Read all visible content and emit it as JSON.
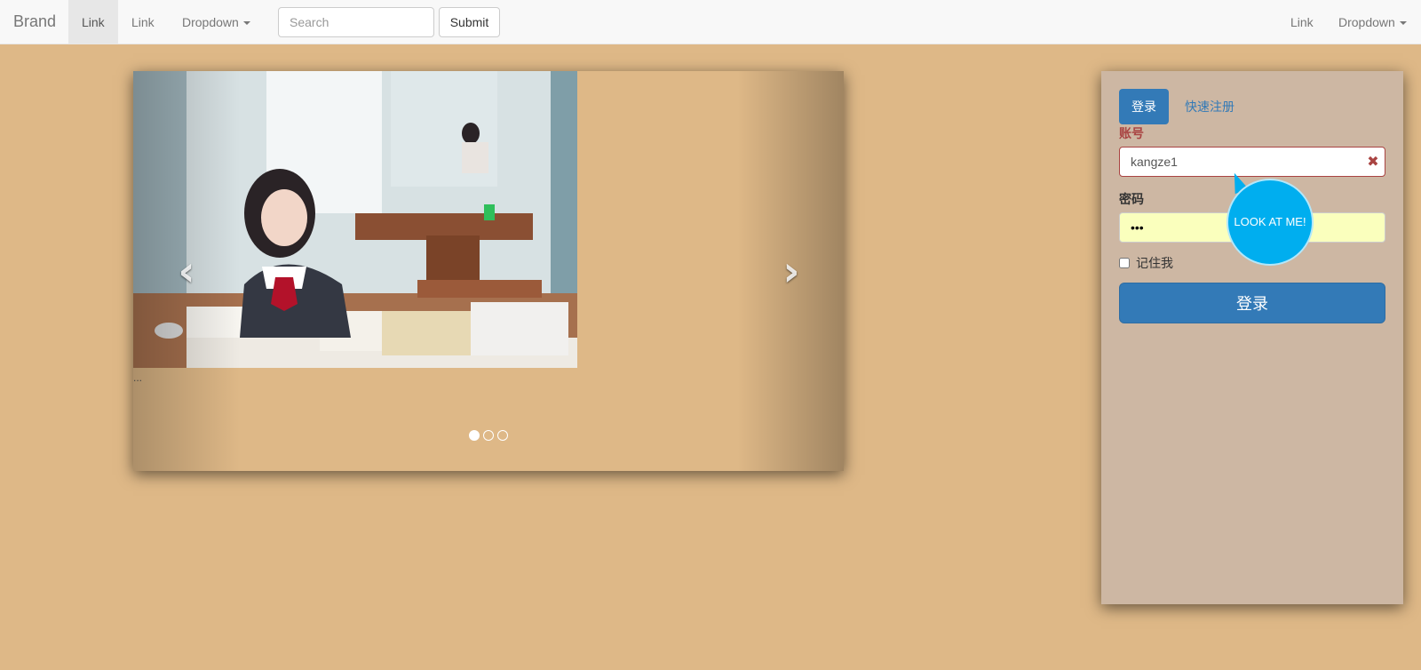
{
  "navbar": {
    "brand": "Brand",
    "left_links": [
      "Link",
      "Link"
    ],
    "dropdown_left": "Dropdown",
    "search": {
      "placeholder": "Search",
      "value": ""
    },
    "submit_label": "Submit",
    "right_link": "Link",
    "dropdown_right": "Dropdown"
  },
  "carousel": {
    "caption": "...",
    "prev_glyph": "‹",
    "next_glyph": "›",
    "slide_count": 3,
    "active_slide": 1
  },
  "login": {
    "tabs": {
      "login": "登录",
      "register": "快速注册"
    },
    "account_label": "账号",
    "account_value": "kangze1",
    "account_error_icon": "remove-icon",
    "password_label": "密码",
    "password_value": "•••",
    "tooltip": "LOOK AT ME!",
    "remember_label": "记住我",
    "remember_checked": false,
    "submit_label": "登录"
  },
  "colors": {
    "page_background": "#deb887",
    "panel_background": "#cdb7a3",
    "primary": "#337ab7",
    "error": "#a94442",
    "tooltip": "#00aeef",
    "autofill": "#faffbd"
  }
}
